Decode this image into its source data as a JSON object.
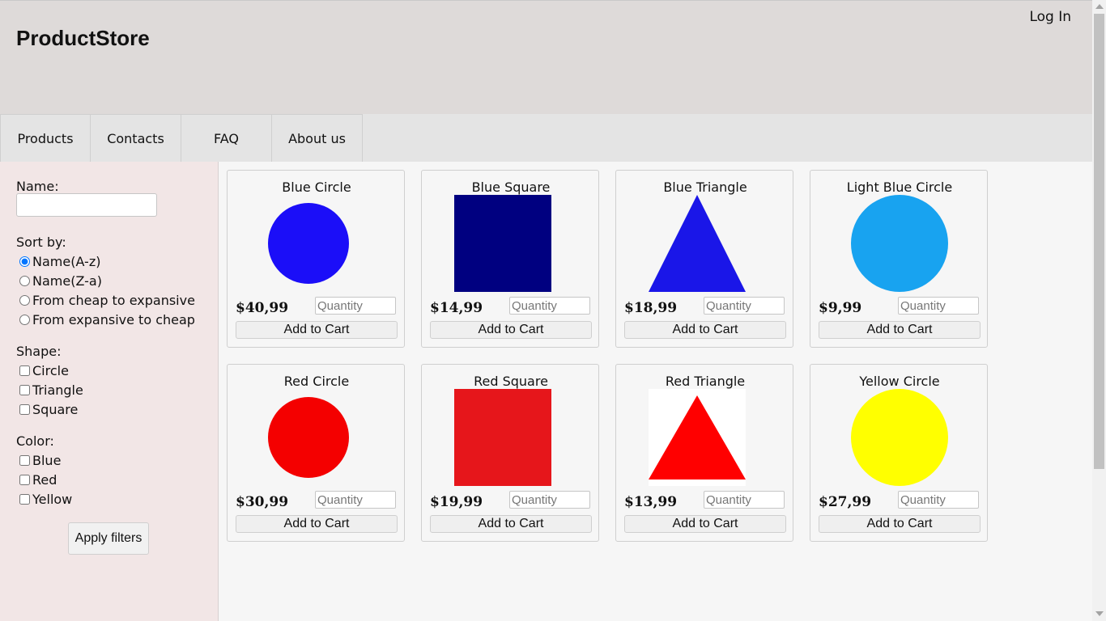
{
  "header": {
    "brand": "ProductStore",
    "login_label": "Log In"
  },
  "nav": {
    "items": [
      "Products",
      "Contacts",
      "FAQ",
      "About us"
    ]
  },
  "filters": {
    "name_label": "Name:",
    "name_value": "",
    "sort_label": "Sort by:",
    "sort_options": [
      "Name(A-z)",
      "Name(Z-a)",
      "From cheap to expansive",
      "From expansive to cheap"
    ],
    "sort_selected": "Name(A-z)",
    "shape_label": "Shape:",
    "shape_options": [
      "Circle",
      "Triangle",
      "Square"
    ],
    "color_label": "Color:",
    "color_options": [
      "Blue",
      "Red",
      "Yellow"
    ],
    "apply_label": "Apply filters"
  },
  "products": [
    {
      "name": "Blue Circle",
      "price": "$40,99",
      "shape": "circle",
      "color": "#1b0ef8"
    },
    {
      "name": "Blue Square",
      "price": "$14,99",
      "shape": "square",
      "color": "#000080"
    },
    {
      "name": "Blue Triangle",
      "price": "$18,99",
      "shape": "triangle",
      "color": "#1a16e8"
    },
    {
      "name": "Light Blue Circle",
      "price": "$9,99",
      "shape": "circle",
      "color": "#18a3f0"
    },
    {
      "name": "Red Circle",
      "price": "$30,99",
      "shape": "circle",
      "color": "#f40000"
    },
    {
      "name": "Red Square",
      "price": "$19,99",
      "shape": "square",
      "color": "#e6161b"
    },
    {
      "name": "Red Triangle",
      "price": "$13,99",
      "shape": "triangle",
      "color": "#ff0000"
    },
    {
      "name": "Yellow Circle",
      "price": "$27,99",
      "shape": "circle",
      "color": "#ffff00"
    }
  ],
  "card": {
    "quantity_placeholder": "Quantity",
    "add_to_cart_label": "Add to Cart"
  }
}
